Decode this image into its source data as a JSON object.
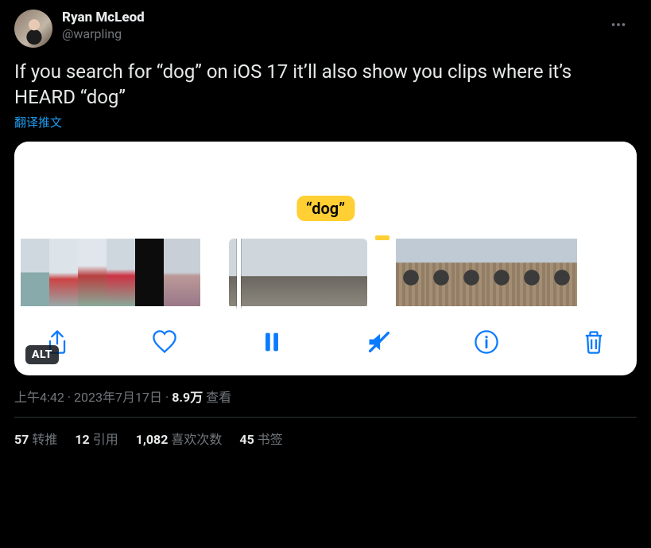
{
  "user": {
    "display_name": "Ryan McLeod",
    "handle": "@warpling"
  },
  "tweet": {
    "body": "If you search for “dog” on iOS 17 it’ll also show you clips where it’s HEARD “dog”",
    "translate_label": "翻译推文"
  },
  "media": {
    "highlight_label": "“dog”",
    "alt_badge": "ALT",
    "toolbar": {
      "share": "share-icon",
      "like": "heart-icon",
      "pause": "pause-icon",
      "mute": "volume-mute-icon",
      "info": "info-icon",
      "trash": "trash-icon"
    }
  },
  "meta": {
    "time": "上午4:42",
    "date": "2023年7月17日",
    "views_count": "8.9万",
    "views_label": "查看"
  },
  "stats": {
    "retweets": {
      "count": "57",
      "label": "转推"
    },
    "quotes": {
      "count": "12",
      "label": "引用"
    },
    "likes": {
      "count": "1,082",
      "label": "喜欢次数"
    },
    "bookmarks": {
      "count": "45",
      "label": "书签"
    }
  }
}
